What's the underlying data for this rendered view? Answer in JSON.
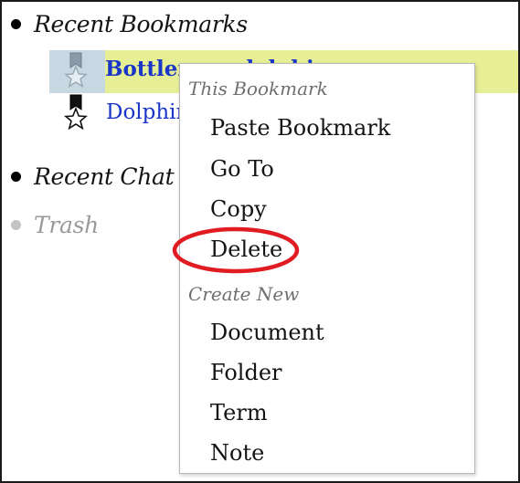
{
  "tree": {
    "recent_bookmarks": "Recent Bookmarks",
    "recent_chats": "Recent Chat",
    "trash": "Trash"
  },
  "bookmarks": [
    {
      "label": "Bottlenose dolphin",
      "selected": true
    },
    {
      "label": "Dolphin",
      "selected": false
    }
  ],
  "context_menu": {
    "section_this_bookmark": "This Bookmark",
    "paste_bookmark": "Paste Bookmark",
    "go_to": "Go To",
    "copy": "Copy",
    "delete": "Delete",
    "section_create_new": "Create New",
    "document": "Document",
    "folder": "Folder",
    "term": "Term",
    "note": "Note"
  },
  "colors": {
    "selection_band": "#e6ef95",
    "icon_cell": "#c8d8e2",
    "link": "#1a36c8",
    "annotation": "#e11b22"
  },
  "icons": {
    "bookmark": "bookmark-star-icon"
  }
}
